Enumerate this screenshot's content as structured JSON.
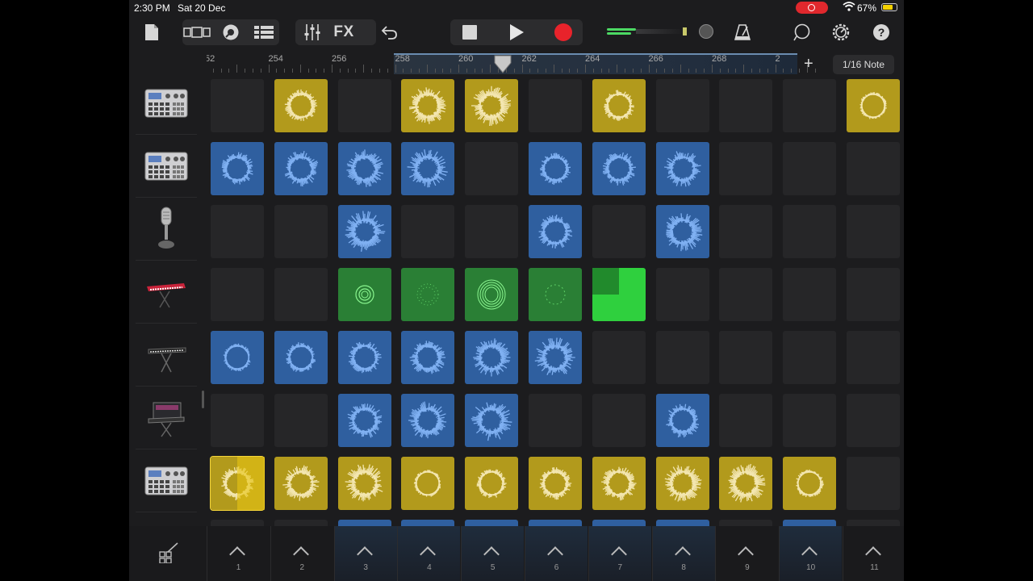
{
  "status_bar": {
    "time": "2:30 PM",
    "date": "Sat 20 Dec",
    "battery": "67%"
  },
  "toolbar": {
    "fx_label": "FX",
    "icons": [
      "document-icon",
      "view-toggle-icon",
      "browser-icon",
      "tracks-view-icon",
      "mixer-icon",
      "undo-icon",
      "stop-icon",
      "play-icon",
      "record-icon",
      "master-volume-icon",
      "metronome-icon",
      "loop-browser-icon",
      "settings-icon",
      "help-icon"
    ],
    "record_color": "#e8232b",
    "help_label": "?"
  },
  "ruler": {
    "bars": [
      "52",
      "254",
      "256",
      "258",
      "260",
      "262",
      "264",
      "266",
      "268",
      "2"
    ],
    "plus_label": "+"
  },
  "quantize": {
    "label": "1/16 Note"
  },
  "instruments": [
    "drum-machine",
    "drum-machine",
    "microphone",
    "red-keyboard",
    "keyboard",
    "synth",
    "drum-machine"
  ],
  "grid": {
    "columns": 11,
    "colors": {
      "yellow": "#b29a1c",
      "blue": "#2f5f9f",
      "green": "#2a7f35",
      "lime": "#2fd03e"
    },
    "rows": [
      [
        "",
        "yellow",
        "",
        "yellow",
        "yellow",
        "",
        "yellow",
        "",
        "",
        "",
        "yellow"
      ],
      [
        "blue",
        "blue",
        "blue",
        "blue",
        "",
        "blue",
        "blue",
        "blue",
        "",
        "",
        ""
      ],
      [
        "",
        "",
        "blue",
        "",
        "",
        "blue",
        "",
        "blue",
        "",
        "",
        ""
      ],
      [
        "",
        "",
        "green",
        "green",
        "green",
        "green",
        "lime",
        "",
        "",
        "",
        ""
      ],
      [
        "blue",
        "blue",
        "blue",
        "blue",
        "blue",
        "blue",
        "",
        "",
        "",
        "",
        ""
      ],
      [
        "",
        "",
        "blue",
        "blue",
        "blue",
        "",
        "",
        "blue",
        "",
        "",
        ""
      ],
      [
        "yellow",
        "yellow",
        "yellow",
        "yellow",
        "yellow",
        "yellow",
        "yellow",
        "yellow",
        "yellow",
        "yellow",
        ""
      ]
    ],
    "peek_row": [
      "",
      "",
      "blue",
      "blue",
      "blue",
      "blue",
      "blue",
      "blue",
      "",
      "blue",
      ""
    ]
  },
  "triggers": [
    "1",
    "2",
    "3",
    "4",
    "5",
    "6",
    "7",
    "8",
    "9",
    "10",
    "11"
  ],
  "lit_triggers": [
    3,
    4,
    5,
    6,
    7,
    8,
    10
  ]
}
